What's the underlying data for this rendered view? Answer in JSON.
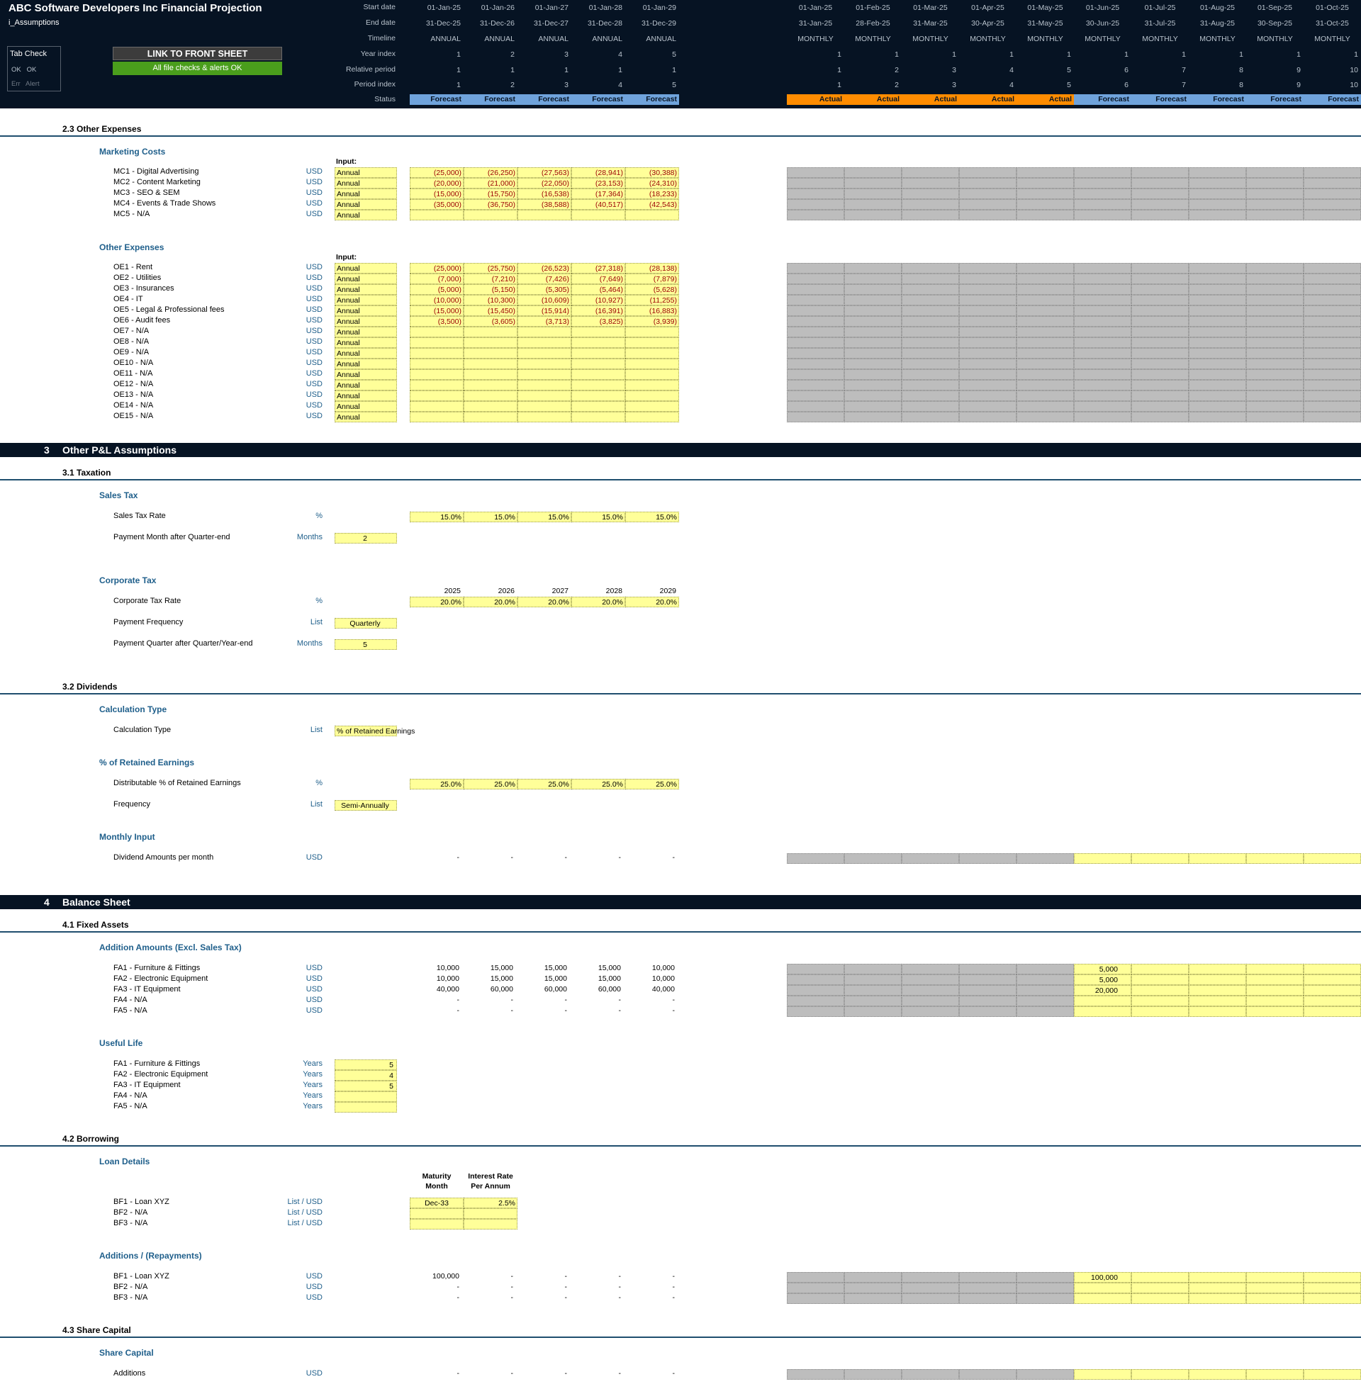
{
  "header": {
    "title": "ABC Software Developers Inc Financial Projection",
    "sheet": "i_Assumptions",
    "tab_check": {
      "title": "Tab Check",
      "row1": "OK   OK",
      "row2": "Err   Alert"
    },
    "link_button": "LINK TO FRONT SHEET",
    "checks_status": "All file checks & alerts OK",
    "row_labels": [
      "Start date",
      "End date",
      "Timeline",
      "Year index",
      "Relative period",
      "Period index",
      "Status"
    ],
    "annual": {
      "start": [
        "01-Jan-25",
        "01-Jan-26",
        "01-Jan-27",
        "01-Jan-28",
        "01-Jan-29"
      ],
      "end": [
        "31-Dec-25",
        "31-Dec-26",
        "31-Dec-27",
        "31-Dec-28",
        "31-Dec-29"
      ],
      "timeline": [
        "ANNUAL",
        "ANNUAL",
        "ANNUAL",
        "ANNUAL",
        "ANNUAL"
      ],
      "year_index": [
        "1",
        "2",
        "3",
        "4",
        "5"
      ],
      "relative": [
        "1",
        "1",
        "1",
        "1",
        "1"
      ],
      "period_index": [
        "1",
        "2",
        "3",
        "4",
        "5"
      ],
      "status": [
        "Forecast",
        "Forecast",
        "Forecast",
        "Forecast",
        "Forecast"
      ]
    },
    "monthly": {
      "start": [
        "01-Jan-25",
        "01-Feb-25",
        "01-Mar-25",
        "01-Apr-25",
        "01-May-25",
        "01-Jun-25",
        "01-Jul-25",
        "01-Aug-25",
        "01-Sep-25",
        "01-Oct-25"
      ],
      "end": [
        "31-Jan-25",
        "28-Feb-25",
        "31-Mar-25",
        "30-Apr-25",
        "31-May-25",
        "30-Jun-25",
        "31-Jul-25",
        "31-Aug-25",
        "30-Sep-25",
        "31-Oct-25"
      ],
      "timeline": [
        "MONTHLY",
        "MONTHLY",
        "MONTHLY",
        "MONTHLY",
        "MONTHLY",
        "MONTHLY",
        "MONTHLY",
        "MONTHLY",
        "MONTHLY",
        "MONTHLY"
      ],
      "year_index": [
        "1",
        "1",
        "1",
        "1",
        "1",
        "1",
        "1",
        "1",
        "1",
        "1"
      ],
      "relative": [
        "1",
        "2",
        "3",
        "4",
        "5",
        "6",
        "7",
        "8",
        "9",
        "10"
      ],
      "period_index": [
        "1",
        "2",
        "3",
        "4",
        "5",
        "6",
        "7",
        "8",
        "9",
        "10"
      ],
      "status": [
        "Actual",
        "Actual",
        "Actual",
        "Actual",
        "Actual",
        "Forecast",
        "Forecast",
        "Forecast",
        "Forecast",
        "Forecast"
      ]
    }
  },
  "colors": {
    "navy": "#061323",
    "forecast": "#6fa3dc",
    "actual": "#ff8c00",
    "input_yellow": "#ffff99",
    "locked_grey": "#bdbdbd",
    "green": "#4a9e1c"
  },
  "other_expenses_section": {
    "title": "2.3   Other Expenses",
    "marketing": {
      "title": "Marketing Costs",
      "input_label": "Input:",
      "rows": [
        {
          "label": "MC1 - Digital Advertising",
          "unit": "USD",
          "input": "Annual",
          "values": [
            "(25,000)",
            "(26,250)",
            "(27,563)",
            "(28,941)",
            "(30,388)"
          ]
        },
        {
          "label": "MC2 - Content Marketing",
          "unit": "USD",
          "input": "Annual",
          "values": [
            "(20,000)",
            "(21,000)",
            "(22,050)",
            "(23,153)",
            "(24,310)"
          ]
        },
        {
          "label": "MC3 - SEO & SEM",
          "unit": "USD",
          "input": "Annual",
          "values": [
            "(15,000)",
            "(15,750)",
            "(16,538)",
            "(17,364)",
            "(18,233)"
          ]
        },
        {
          "label": "MC4 - Events & Trade Shows",
          "unit": "USD",
          "input": "Annual",
          "values": [
            "(35,000)",
            "(36,750)",
            "(38,588)",
            "(40,517)",
            "(42,543)"
          ]
        },
        {
          "label": "MC5 - N/A",
          "unit": "USD",
          "input": "Annual",
          "values": [
            "",
            "",
            "",
            "",
            ""
          ]
        }
      ]
    },
    "other": {
      "title": "Other Expenses",
      "input_label": "Input:",
      "rows": [
        {
          "label": "OE1 - Rent",
          "unit": "USD",
          "input": "Annual",
          "values": [
            "(25,000)",
            "(25,750)",
            "(26,523)",
            "(27,318)",
            "(28,138)"
          ]
        },
        {
          "label": "OE2 - Utilities",
          "unit": "USD",
          "input": "Annual",
          "values": [
            "(7,000)",
            "(7,210)",
            "(7,426)",
            "(7,649)",
            "(7,879)"
          ]
        },
        {
          "label": "OE3 - Insurances",
          "unit": "USD",
          "input": "Annual",
          "values": [
            "(5,000)",
            "(5,150)",
            "(5,305)",
            "(5,464)",
            "(5,628)"
          ]
        },
        {
          "label": "OE4 - IT",
          "unit": "USD",
          "input": "Annual",
          "values": [
            "(10,000)",
            "(10,300)",
            "(10,609)",
            "(10,927)",
            "(11,255)"
          ]
        },
        {
          "label": "OE5 - Legal & Professional fees",
          "unit": "USD",
          "input": "Annual",
          "values": [
            "(15,000)",
            "(15,450)",
            "(15,914)",
            "(16,391)",
            "(16,883)"
          ]
        },
        {
          "label": "OE6 - Audit fees",
          "unit": "USD",
          "input": "Annual",
          "values": [
            "(3,500)",
            "(3,605)",
            "(3,713)",
            "(3,825)",
            "(3,939)"
          ]
        },
        {
          "label": "OE7 - N/A",
          "unit": "USD",
          "input": "Annual",
          "values": [
            "",
            "",
            "",
            "",
            ""
          ]
        },
        {
          "label": "OE8 - N/A",
          "unit": "USD",
          "input": "Annual",
          "values": [
            "",
            "",
            "",
            "",
            ""
          ]
        },
        {
          "label": "OE9 - N/A",
          "unit": "USD",
          "input": "Annual",
          "values": [
            "",
            "",
            "",
            "",
            ""
          ]
        },
        {
          "label": "OE10 - N/A",
          "unit": "USD",
          "input": "Annual",
          "values": [
            "",
            "",
            "",
            "",
            ""
          ]
        },
        {
          "label": "OE11 - N/A",
          "unit": "USD",
          "input": "Annual",
          "values": [
            "",
            "",
            "",
            "",
            ""
          ]
        },
        {
          "label": "OE12 - N/A",
          "unit": "USD",
          "input": "Annual",
          "values": [
            "",
            "",
            "",
            "",
            ""
          ]
        },
        {
          "label": "OE13 - N/A",
          "unit": "USD",
          "input": "Annual",
          "values": [
            "",
            "",
            "",
            "",
            ""
          ]
        },
        {
          "label": "OE14 - N/A",
          "unit": "USD",
          "input": "Annual",
          "values": [
            "",
            "",
            "",
            "",
            ""
          ]
        },
        {
          "label": "OE15 - N/A",
          "unit": "USD",
          "input": "Annual",
          "values": [
            "",
            "",
            "",
            "",
            ""
          ]
        }
      ]
    }
  },
  "section3": {
    "num": "3",
    "title": "Other P&L Assumptions",
    "taxation": {
      "title": "3.1   Taxation",
      "sales_tax_title": "Sales Tax",
      "sales_tax_rate": {
        "label": "Sales Tax Rate",
        "unit": "%",
        "values": [
          "15.0%",
          "15.0%",
          "15.0%",
          "15.0%",
          "15.0%"
        ]
      },
      "payment_month": {
        "label": "Payment Month after Quarter-end",
        "unit": "Months",
        "value": "2"
      },
      "corp_tax_title": "Corporate Tax",
      "years": [
        "2025",
        "2026",
        "2027",
        "2028",
        "2029"
      ],
      "corp_tax_rate": {
        "label": "Corporate Tax Rate",
        "unit": "%",
        "values": [
          "20.0%",
          "20.0%",
          "20.0%",
          "20.0%",
          "20.0%"
        ]
      },
      "payment_freq": {
        "label": "Payment Frequency",
        "unit": "List",
        "value": "Quarterly"
      },
      "payment_quarter": {
        "label": "Payment Quarter after Quarter/Year-end",
        "unit": "Months",
        "value": "5"
      }
    },
    "dividends": {
      "title": "3.2   Dividends",
      "calc_type_title": "Calculation Type",
      "calc_type": {
        "label": "Calculation Type",
        "unit": "List",
        "value": "% of Retained Earnings"
      },
      "pct_title": "% of Retained Earnings",
      "distributable": {
        "label": "Distributable % of Retained Earnings",
        "unit": "%",
        "values": [
          "25.0%",
          "25.0%",
          "25.0%",
          "25.0%",
          "25.0%"
        ]
      },
      "frequency": {
        "label": "Frequency",
        "unit": "List",
        "value": "Semi-Annually"
      },
      "monthly_title": "Monthly Input",
      "monthly_amounts": {
        "label": "Dividend Amounts per month",
        "unit": "USD",
        "values": [
          "-",
          "-",
          "-",
          "-",
          "-"
        ]
      }
    }
  },
  "section4": {
    "num": "4",
    "title": "Balance Sheet",
    "fixed_assets": {
      "title": "4.1   Fixed Assets",
      "additions_title": "Addition Amounts (Excl. Sales Tax)",
      "additions": [
        {
          "label": "FA1 - Furniture & Fittings",
          "unit": "USD",
          "values": [
            "10,000",
            "15,000",
            "15,000",
            "15,000",
            "10,000"
          ],
          "jun": "5,000"
        },
        {
          "label": "FA2 - Electronic Equipment",
          "unit": "USD",
          "values": [
            "10,000",
            "15,000",
            "15,000",
            "15,000",
            "10,000"
          ],
          "jun": "5,000"
        },
        {
          "label": "FA3 - IT Equipment",
          "unit": "USD",
          "values": [
            "40,000",
            "60,000",
            "60,000",
            "60,000",
            "40,000"
          ],
          "jun": "20,000"
        },
        {
          "label": "FA4 - N/A",
          "unit": "USD",
          "values": [
            "-",
            "-",
            "-",
            "-",
            "-"
          ],
          "jun": ""
        },
        {
          "label": "FA5 - N/A",
          "unit": "USD",
          "values": [
            "-",
            "-",
            "-",
            "-",
            "-"
          ],
          "jun": ""
        }
      ],
      "useful_life_title": "Useful Life",
      "useful_life": [
        {
          "label": "FA1 - Furniture & Fittings",
          "unit": "Years",
          "value": "5"
        },
        {
          "label": "FA2 - Electronic Equipment",
          "unit": "Years",
          "value": "4"
        },
        {
          "label": "FA3 - IT Equipment",
          "unit": "Years",
          "value": "5"
        },
        {
          "label": "FA4 - N/A",
          "unit": "Years",
          "value": ""
        },
        {
          "label": "FA5 - N/A",
          "unit": "Years",
          "value": ""
        }
      ]
    },
    "borrowing": {
      "title": "4.2   Borrowing",
      "loan_title": "Loan Details",
      "col1": [
        "Maturity",
        "Month"
      ],
      "col2": [
        "Interest Rate",
        "Per Annum"
      ],
      "loans": [
        {
          "label": "BF1 - Loan XYZ",
          "unit": "List / USD",
          "maturity": "Dec-33",
          "rate": "2.5%"
        },
        {
          "label": "BF2 - N/A",
          "unit": "List / USD",
          "maturity": "",
          "rate": ""
        },
        {
          "label": "BF3 - N/A",
          "unit": "List / USD",
          "maturity": "",
          "rate": ""
        }
      ],
      "additions_title": "Additions / (Repayments)",
      "additions": [
        {
          "label": "BF1 - Loan XYZ",
          "unit": "USD",
          "values": [
            "100,000",
            "-",
            "-",
            "-",
            "-"
          ],
          "jun": "100,000"
        },
        {
          "label": "BF2 - N/A",
          "unit": "USD",
          "values": [
            "-",
            "-",
            "-",
            "-",
            "-"
          ],
          "jun": ""
        },
        {
          "label": "BF3 - N/A",
          "unit": "USD",
          "values": [
            "-",
            "-",
            "-",
            "-",
            "-"
          ],
          "jun": ""
        }
      ]
    },
    "share_capital": {
      "title": "4.3   Share Capital",
      "group_title": "Share Capital",
      "additions": {
        "label": "Additions",
        "unit": "USD",
        "values": [
          "-",
          "-",
          "-",
          "-",
          "-"
        ]
      }
    }
  }
}
